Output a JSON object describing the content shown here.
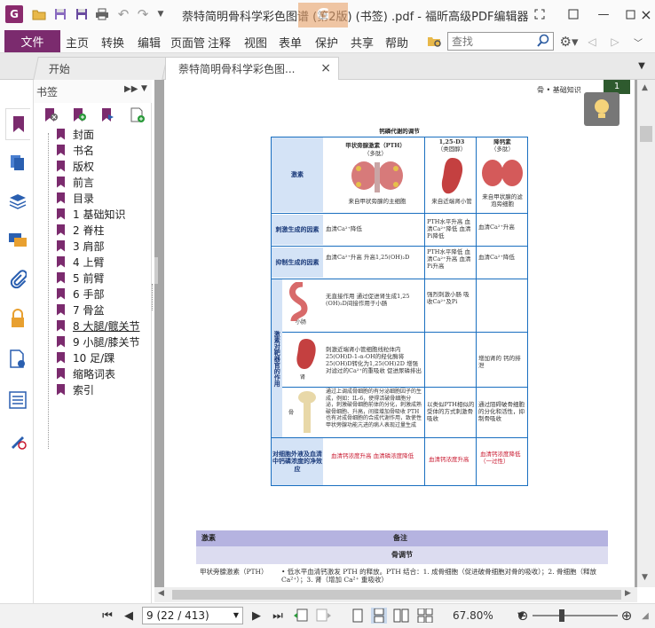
{
  "app": {
    "logo_letter": "G",
    "window_title": "萘特简明骨科学彩色图谱 (第2版) (书签) .pdf - 福昕高级PDF编辑器",
    "watermark": "G"
  },
  "menu": {
    "file": "文件",
    "items": [
      "主页",
      "转换",
      "编辑",
      "页面管",
      "注释",
      "视图",
      "表单",
      "保护",
      "共享",
      "帮助"
    ]
  },
  "search": {
    "placeholder": "查找"
  },
  "tabs": [
    {
      "label": "开始"
    },
    {
      "label": "萘特简明骨科学彩色图..."
    }
  ],
  "bookmarks": {
    "header": "书签",
    "items": [
      {
        "label": "封面"
      },
      {
        "label": "书名"
      },
      {
        "label": "版权"
      },
      {
        "label": "前言"
      },
      {
        "label": "目录"
      },
      {
        "label": "1 基础知识"
      },
      {
        "label": "2 脊柱"
      },
      {
        "label": "3 肩部"
      },
      {
        "label": "4 上臂"
      },
      {
        "label": "5 前臂"
      },
      {
        "label": "6 手部"
      },
      {
        "label": "7 骨盆"
      },
      {
        "label": "8 大腿/髋关节"
      },
      {
        "label": "9 小腿/膝关节"
      },
      {
        "label": "10 足/踝"
      },
      {
        "label": "缩略词表"
      },
      {
        "label": "索引"
      }
    ]
  },
  "page": {
    "header": "骨 • 基础知识",
    "page_num": "1",
    "table_title": "钙磷代谢的调节",
    "col1_title": "甲状旁腺激素（PTH）",
    "col1_sub": "（多肽）",
    "col2_title": "1,25-D3",
    "col2_sub": "（类固醇）",
    "col3_title": "降钙素",
    "col3_sub": "（多肽）",
    "row_hormone": "激素",
    "col1_source": "来自甲状旁腺的主细胞",
    "col2_source": "来自近端肾小管",
    "col3_source": "来自甲状腺的滤泡旁细胞",
    "row_stim": "刺激生成的因素",
    "stim1": "血清Ca²⁺降低",
    "stim2": "PTH水平升高 血清Ca²⁺降低 血清Pi降低",
    "stim3": "血清Ca²⁺升高",
    "row_inhib": "抑制生成的因素",
    "inhib1": "血清Ca²⁺升高 升高1,25(OH)₂D",
    "inhib2": "PTH水平降低 血清Ca²⁺升高 血清Pi升高",
    "inhib3": "血清Ca²⁺降低",
    "side_label": "激素对靶器官的作用",
    "organ_gut": "小肠",
    "gut1": "无直接作用 通过促进肾生成1,25 (OH)₂D间接作用于小肠",
    "gut2": "强烈刺激小肠 吸收Ca²⁺及Pi",
    "organ_kidney": "肾",
    "kidney1": "刺激近端肾小管细胞线粒体内 25(OH)D-1-α-OH的羟化酶将 25(OH)D转化为1,25(OH)2D 增强对滤过的Ca²⁺的重吸收 促进尿磷排出",
    "kidney3": "增加肾的 钙的排泄",
    "organ_bone": "骨",
    "bone1": "通过上调成骨细胞的有分泌细胞因子的生成，例如：IL-6，使得活破骨细胞分泌，刺激破骨细胞前体的分化，刺激成熟破骨细胞、升高，间接增加骨吸收 PTH也有对成骨细胞的合成代谢作用，致使性甲状旁腺功能亢进的病人表现过量生成",
    "bone2": "以类似PTH相似的受体的方式刺激骨吸收",
    "bone3": "通过阻碍破骨细胞的分化和活性，抑制骨吸收",
    "row_net": "对细胞外液及血清中钙磷浓度的净效应",
    "net1": "血清钙浓度升高 血清磷浓度降低",
    "net2": "血清钙浓度升高",
    "net3": "血清钙浓度降低（一过性）",
    "notes_col1": "激素",
    "notes_col2": "备注",
    "notes_section": "骨调节",
    "notes_row_label": "甲状旁腺激素（PTH）",
    "notes_row_text": "• 低水平血清钙激发 PTH 的释放。PTH 结合：1. 成骨细胞（促进破骨细胞对骨的吸收）；2. 骨细胞（释放 Ca²⁺）；3. 肾（增加 Ca²⁺ 重吸收）"
  },
  "status": {
    "page_field": "9 (22 / 413)",
    "zoom": "67.80%"
  }
}
